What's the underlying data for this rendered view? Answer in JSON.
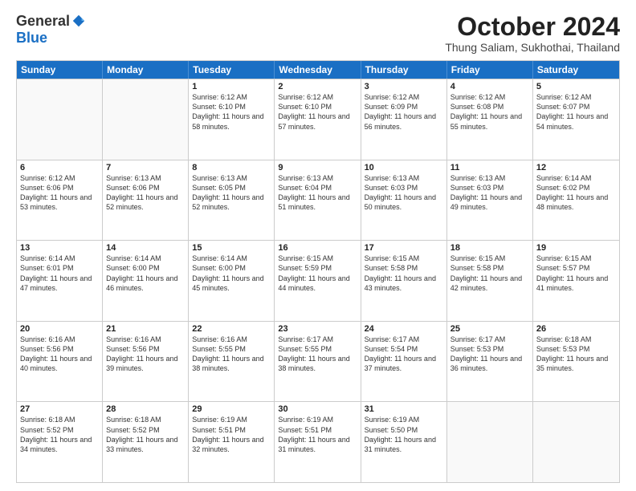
{
  "logo": {
    "general": "General",
    "blue": "Blue"
  },
  "title": "October 2024",
  "location": "Thung Saliam, Sukhothai, Thailand",
  "header_days": [
    "Sunday",
    "Monday",
    "Tuesday",
    "Wednesday",
    "Thursday",
    "Friday",
    "Saturday"
  ],
  "weeks": [
    [
      {
        "day": "",
        "empty": true
      },
      {
        "day": "",
        "empty": true
      },
      {
        "day": "1",
        "sunrise": "Sunrise: 6:12 AM",
        "sunset": "Sunset: 6:10 PM",
        "daylight": "Daylight: 11 hours and 58 minutes."
      },
      {
        "day": "2",
        "sunrise": "Sunrise: 6:12 AM",
        "sunset": "Sunset: 6:10 PM",
        "daylight": "Daylight: 11 hours and 57 minutes."
      },
      {
        "day": "3",
        "sunrise": "Sunrise: 6:12 AM",
        "sunset": "Sunset: 6:09 PM",
        "daylight": "Daylight: 11 hours and 56 minutes."
      },
      {
        "day": "4",
        "sunrise": "Sunrise: 6:12 AM",
        "sunset": "Sunset: 6:08 PM",
        "daylight": "Daylight: 11 hours and 55 minutes."
      },
      {
        "day": "5",
        "sunrise": "Sunrise: 6:12 AM",
        "sunset": "Sunset: 6:07 PM",
        "daylight": "Daylight: 11 hours and 54 minutes."
      }
    ],
    [
      {
        "day": "6",
        "sunrise": "Sunrise: 6:12 AM",
        "sunset": "Sunset: 6:06 PM",
        "daylight": "Daylight: 11 hours and 53 minutes."
      },
      {
        "day": "7",
        "sunrise": "Sunrise: 6:13 AM",
        "sunset": "Sunset: 6:06 PM",
        "daylight": "Daylight: 11 hours and 52 minutes."
      },
      {
        "day": "8",
        "sunrise": "Sunrise: 6:13 AM",
        "sunset": "Sunset: 6:05 PM",
        "daylight": "Daylight: 11 hours and 52 minutes."
      },
      {
        "day": "9",
        "sunrise": "Sunrise: 6:13 AM",
        "sunset": "Sunset: 6:04 PM",
        "daylight": "Daylight: 11 hours and 51 minutes."
      },
      {
        "day": "10",
        "sunrise": "Sunrise: 6:13 AM",
        "sunset": "Sunset: 6:03 PM",
        "daylight": "Daylight: 11 hours and 50 minutes."
      },
      {
        "day": "11",
        "sunrise": "Sunrise: 6:13 AM",
        "sunset": "Sunset: 6:03 PM",
        "daylight": "Daylight: 11 hours and 49 minutes."
      },
      {
        "day": "12",
        "sunrise": "Sunrise: 6:14 AM",
        "sunset": "Sunset: 6:02 PM",
        "daylight": "Daylight: 11 hours and 48 minutes."
      }
    ],
    [
      {
        "day": "13",
        "sunrise": "Sunrise: 6:14 AM",
        "sunset": "Sunset: 6:01 PM",
        "daylight": "Daylight: 11 hours and 47 minutes."
      },
      {
        "day": "14",
        "sunrise": "Sunrise: 6:14 AM",
        "sunset": "Sunset: 6:00 PM",
        "daylight": "Daylight: 11 hours and 46 minutes."
      },
      {
        "day": "15",
        "sunrise": "Sunrise: 6:14 AM",
        "sunset": "Sunset: 6:00 PM",
        "daylight": "Daylight: 11 hours and 45 minutes."
      },
      {
        "day": "16",
        "sunrise": "Sunrise: 6:15 AM",
        "sunset": "Sunset: 5:59 PM",
        "daylight": "Daylight: 11 hours and 44 minutes."
      },
      {
        "day": "17",
        "sunrise": "Sunrise: 6:15 AM",
        "sunset": "Sunset: 5:58 PM",
        "daylight": "Daylight: 11 hours and 43 minutes."
      },
      {
        "day": "18",
        "sunrise": "Sunrise: 6:15 AM",
        "sunset": "Sunset: 5:58 PM",
        "daylight": "Daylight: 11 hours and 42 minutes."
      },
      {
        "day": "19",
        "sunrise": "Sunrise: 6:15 AM",
        "sunset": "Sunset: 5:57 PM",
        "daylight": "Daylight: 11 hours and 41 minutes."
      }
    ],
    [
      {
        "day": "20",
        "sunrise": "Sunrise: 6:16 AM",
        "sunset": "Sunset: 5:56 PM",
        "daylight": "Daylight: 11 hours and 40 minutes."
      },
      {
        "day": "21",
        "sunrise": "Sunrise: 6:16 AM",
        "sunset": "Sunset: 5:56 PM",
        "daylight": "Daylight: 11 hours and 39 minutes."
      },
      {
        "day": "22",
        "sunrise": "Sunrise: 6:16 AM",
        "sunset": "Sunset: 5:55 PM",
        "daylight": "Daylight: 11 hours and 38 minutes."
      },
      {
        "day": "23",
        "sunrise": "Sunrise: 6:17 AM",
        "sunset": "Sunset: 5:55 PM",
        "daylight": "Daylight: 11 hours and 38 minutes."
      },
      {
        "day": "24",
        "sunrise": "Sunrise: 6:17 AM",
        "sunset": "Sunset: 5:54 PM",
        "daylight": "Daylight: 11 hours and 37 minutes."
      },
      {
        "day": "25",
        "sunrise": "Sunrise: 6:17 AM",
        "sunset": "Sunset: 5:53 PM",
        "daylight": "Daylight: 11 hours and 36 minutes."
      },
      {
        "day": "26",
        "sunrise": "Sunrise: 6:18 AM",
        "sunset": "Sunset: 5:53 PM",
        "daylight": "Daylight: 11 hours and 35 minutes."
      }
    ],
    [
      {
        "day": "27",
        "sunrise": "Sunrise: 6:18 AM",
        "sunset": "Sunset: 5:52 PM",
        "daylight": "Daylight: 11 hours and 34 minutes."
      },
      {
        "day": "28",
        "sunrise": "Sunrise: 6:18 AM",
        "sunset": "Sunset: 5:52 PM",
        "daylight": "Daylight: 11 hours and 33 minutes."
      },
      {
        "day": "29",
        "sunrise": "Sunrise: 6:19 AM",
        "sunset": "Sunset: 5:51 PM",
        "daylight": "Daylight: 11 hours and 32 minutes."
      },
      {
        "day": "30",
        "sunrise": "Sunrise: 6:19 AM",
        "sunset": "Sunset: 5:51 PM",
        "daylight": "Daylight: 11 hours and 31 minutes."
      },
      {
        "day": "31",
        "sunrise": "Sunrise: 6:19 AM",
        "sunset": "Sunset: 5:50 PM",
        "daylight": "Daylight: 11 hours and 31 minutes."
      },
      {
        "day": "",
        "empty": true
      },
      {
        "day": "",
        "empty": true
      }
    ]
  ]
}
